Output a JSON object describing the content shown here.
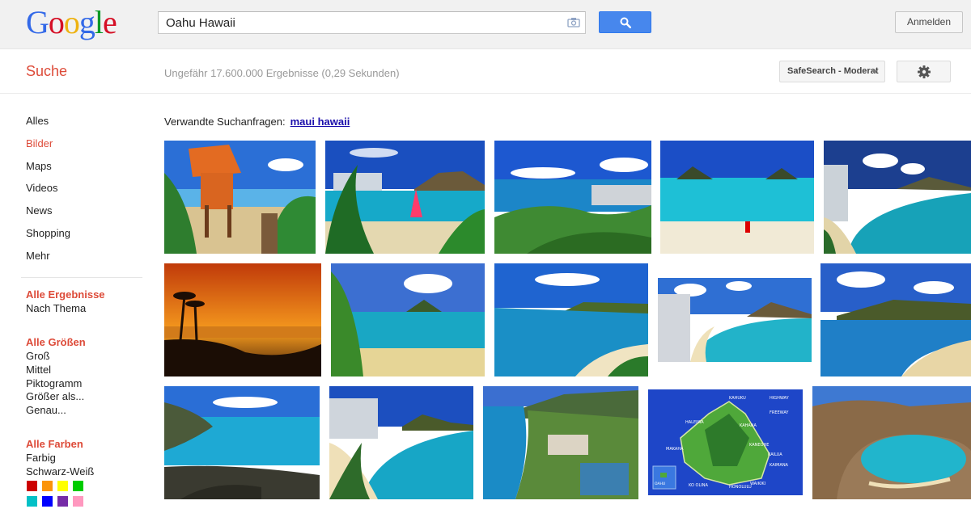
{
  "header": {
    "logo_letters": [
      "G",
      "o",
      "o",
      "g",
      "l",
      "e"
    ],
    "logo_colors": [
      "#3369e8",
      "#d50f25",
      "#eeb211",
      "#3369e8",
      "#009925",
      "#d50f25"
    ],
    "search_value": "Oahu Hawaii",
    "search_icon": "magnifier-icon",
    "camera_icon": "camera-icon",
    "signin_label": "Anmelden"
  },
  "subbar": {
    "section_title": "Suche",
    "result_stats": "Ungefähr 17.600.000 Ergebnisse (0,29 Sekunden)",
    "safesearch_label": "SafeSearch - Moderat",
    "settings_icon": "gear-icon"
  },
  "nav": {
    "items": [
      {
        "label": "Alles",
        "active": false
      },
      {
        "label": "Bilder",
        "active": true
      },
      {
        "label": "Maps",
        "active": false
      },
      {
        "label": "Videos",
        "active": false
      },
      {
        "label": "News",
        "active": false
      },
      {
        "label": "Shopping",
        "active": false
      },
      {
        "label": "Mehr",
        "active": false
      }
    ]
  },
  "filters": {
    "results_head": "Alle Ergebnisse",
    "results_items": [
      "Nach Thema"
    ],
    "sizes_head": "Alle Größen",
    "sizes_items": [
      "Groß",
      "Mittel",
      "Piktogramm",
      "Größer als...",
      "Genau..."
    ],
    "colors_head": "Alle Farben",
    "colors_items": [
      "Farbig",
      "Schwarz-Weiß"
    ],
    "swatches": [
      "#cc0000",
      "#fb940b",
      "#ffff00",
      "#00cc00",
      "#03c0c6",
      "#0000ff",
      "#762ca7",
      "#ff98bf"
    ]
  },
  "related": {
    "label": "Verwandte Suchanfragen:",
    "link": "maui hawaii"
  },
  "images": {
    "map_labels": {
      "kahuku": "KAHUKU",
      "haleiwa": "HALEIWA",
      "kahana": "KAHANA",
      "makaha": "MAKAHA",
      "kaneohe": "KANEOHE",
      "kailua": "KAILUA",
      "honolulu": "HONOLULU",
      "waikiki": "WAIKIKI",
      "kaimana": "KAIMANA",
      "highway": "HIGHWAY",
      "freeway": "FREEWAY",
      "oahu": "OAHU",
      "ko_olina": "KO OLINA"
    }
  }
}
